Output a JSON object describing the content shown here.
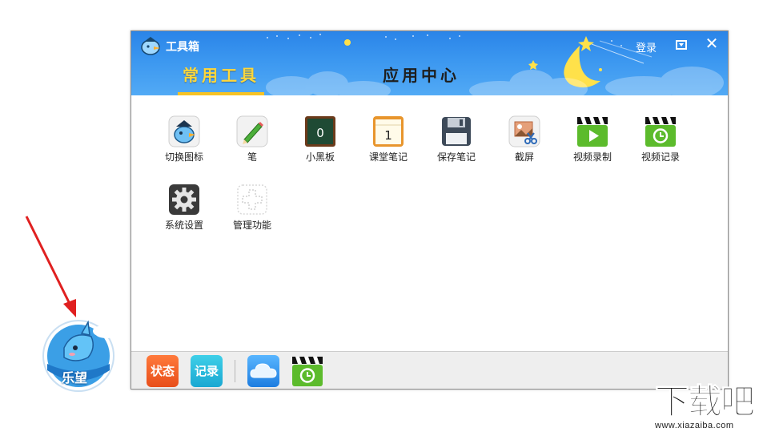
{
  "window": {
    "title": "工具箱",
    "login": "登录",
    "tabs": [
      {
        "label": "常用工具",
        "active": true
      },
      {
        "label": "应用中心",
        "active": false
      }
    ]
  },
  "tools": [
    {
      "label": "切换图标",
      "icon": "bird-mascot-icon"
    },
    {
      "label": "笔",
      "icon": "pencil-icon"
    },
    {
      "label": "小黑板",
      "icon": "blackboard-icon",
      "badge": "0"
    },
    {
      "label": "课堂笔记",
      "icon": "notebook-icon",
      "badge": "1"
    },
    {
      "label": "保存笔记",
      "icon": "floppy-disk-icon"
    },
    {
      "label": "截屏",
      "icon": "screenshot-scissors-icon"
    },
    {
      "label": "视频录制",
      "icon": "video-clapper-play-icon"
    },
    {
      "label": "视频记录",
      "icon": "video-clapper-clock-icon"
    },
    {
      "label": "系统设置",
      "icon": "gear-icon"
    },
    {
      "label": "管理功能",
      "icon": "add-dotted-icon"
    }
  ],
  "bottombar": {
    "status_label": "状态",
    "record_label": "记录",
    "cloud_icon": "cloud-icon",
    "video_icon": "video-clapper-clock-icon"
  },
  "desktop": {
    "widget_label": "乐望",
    "watermark_main": "下载吧",
    "watermark_url": "www.xiazaiba.com"
  },
  "colors": {
    "header_blue": "#3b97f0",
    "active_tab": "#ffd73a",
    "arrow_red": "#e02020"
  }
}
